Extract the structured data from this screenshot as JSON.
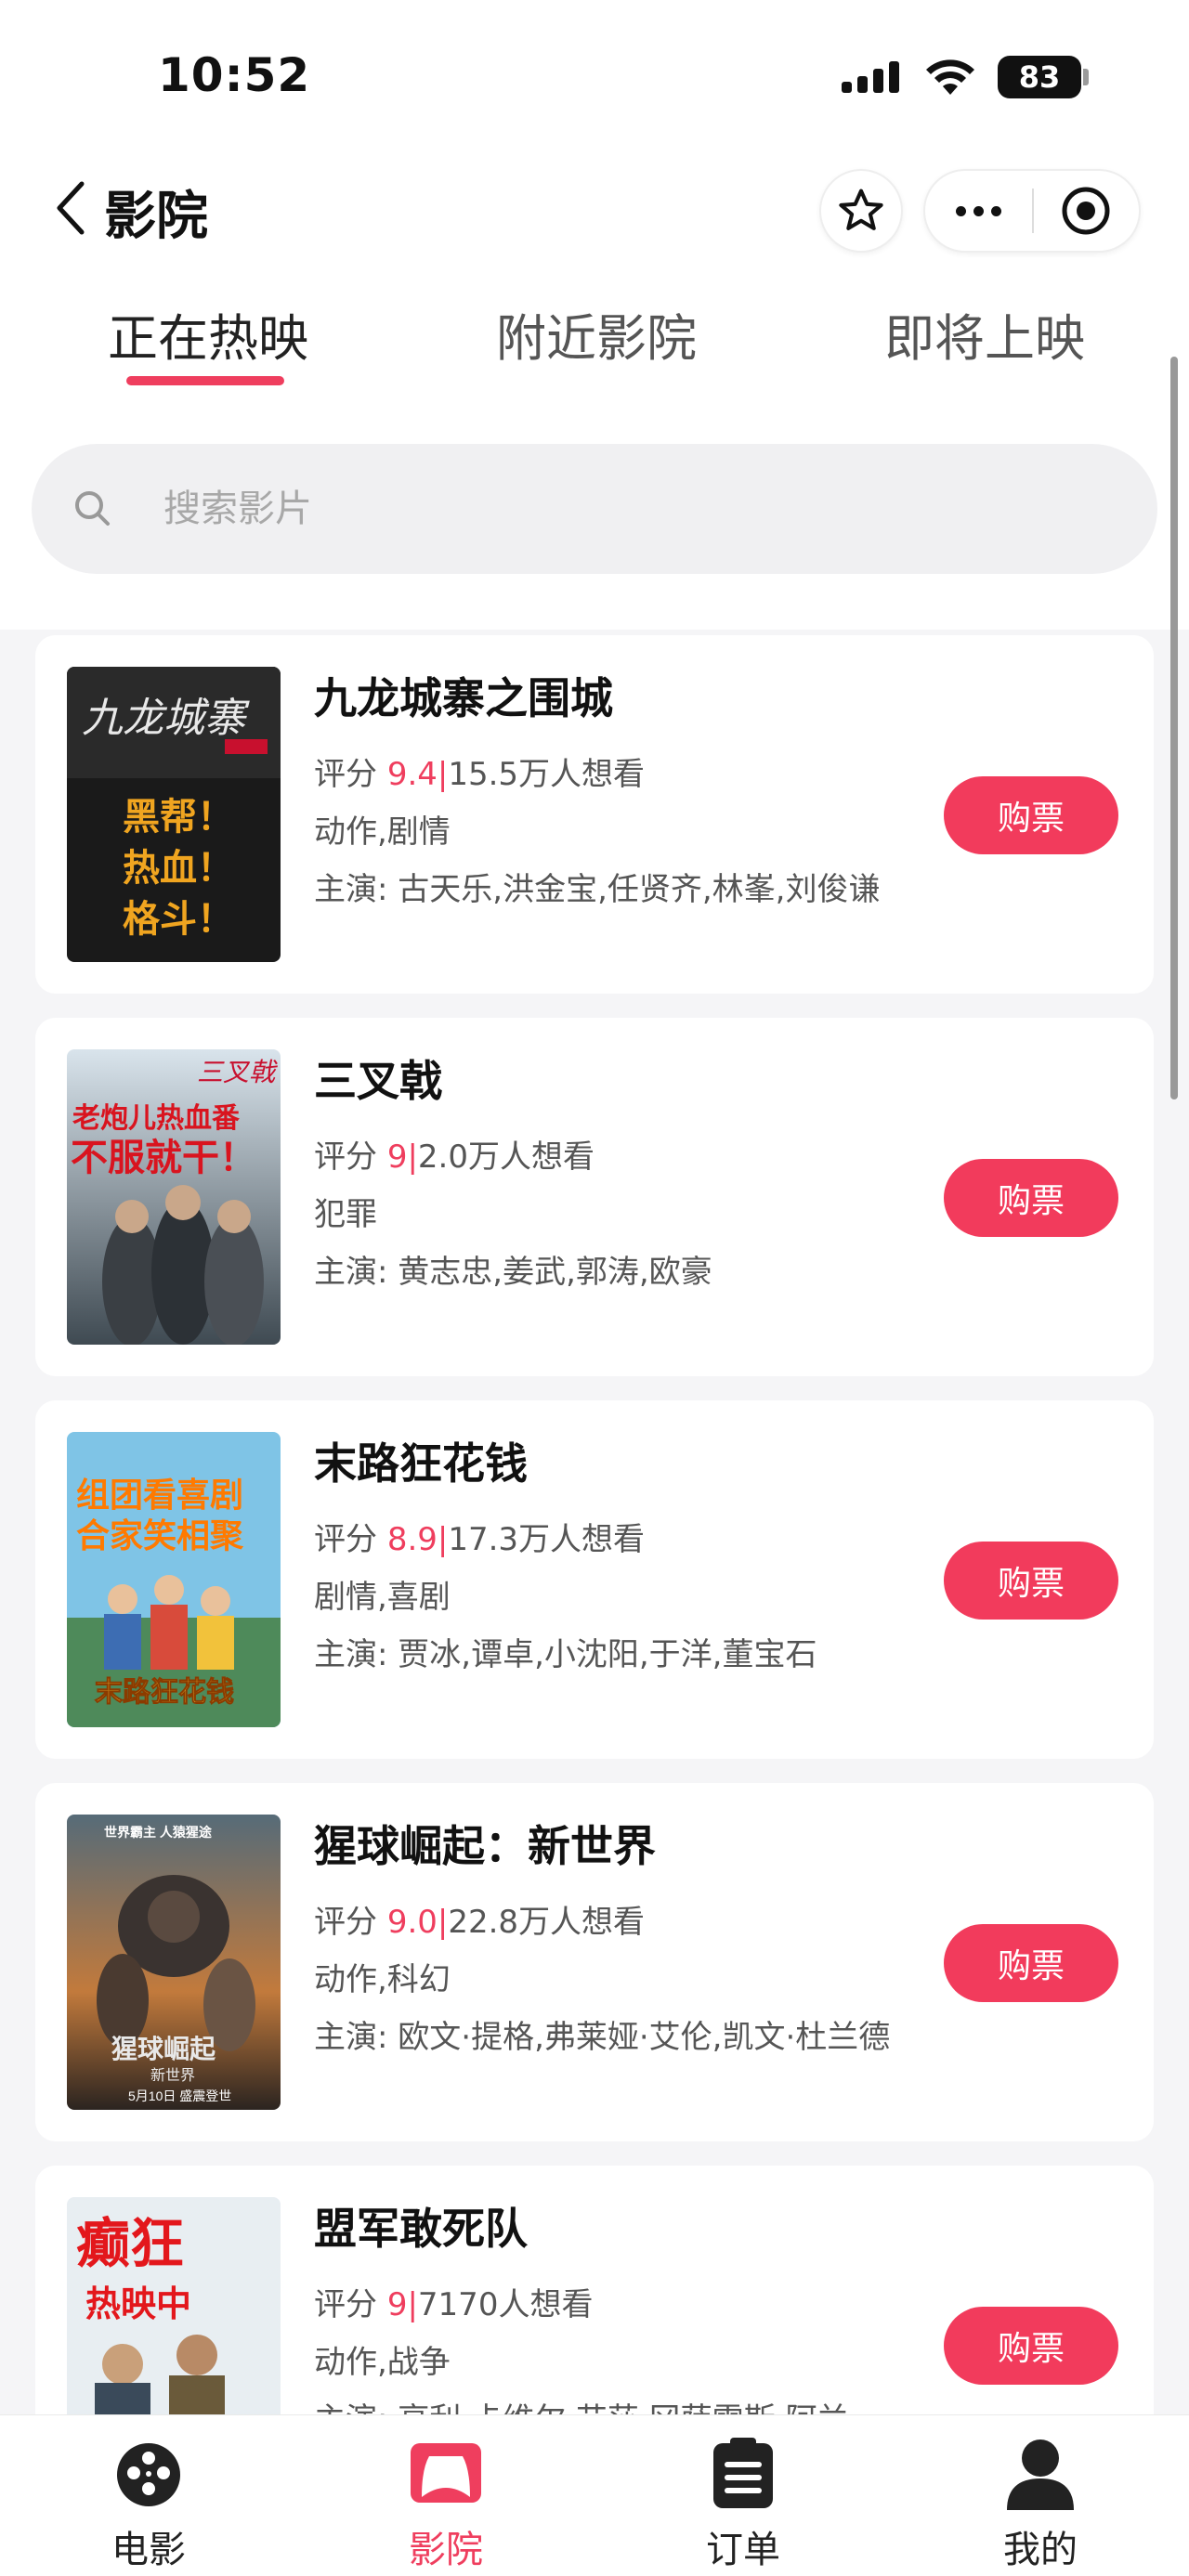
{
  "status_bar": {
    "time": "10:52",
    "battery": "83"
  },
  "nav": {
    "title": "影院"
  },
  "tabs": [
    {
      "label": "正在热映",
      "active": true
    },
    {
      "label": "附近影院",
      "active": false
    },
    {
      "label": "即将上映",
      "active": false
    }
  ],
  "search": {
    "placeholder": "搜索影片"
  },
  "movies": [
    {
      "title": "九龙城寨之围城",
      "rating_label": "评分",
      "score": "9.4",
      "want": "15.5万人想看",
      "genre": "动作,剧情",
      "cast": "主演: 古天乐,洪金宝,任贤齐,林峯,刘俊谦",
      "buy_label": "购票",
      "poster_text": [
        "九龙城寨",
        "黑帮！",
        "热血！",
        "格斗！"
      ]
    },
    {
      "title": "三叉戟",
      "rating_label": "评分",
      "score": "9",
      "want": "2.0万人想看",
      "genre": "犯罪",
      "cast": "主演: 黄志忠,姜武,郭涛,欧豪",
      "buy_label": "购票",
      "poster_text": [
        "三叉戟",
        "老炮儿热血番",
        "不服就干！"
      ]
    },
    {
      "title": "末路狂花钱",
      "rating_label": "评分",
      "score": "8.9",
      "want": "17.3万人想看",
      "genre": "剧情,喜剧",
      "cast": "主演: 贾冰,谭卓,小沈阳,于洋,董宝石",
      "buy_label": "购票",
      "poster_text": [
        "组团看喜剧",
        "合家笑相聚",
        "末路狂花钱"
      ]
    },
    {
      "title": "猩球崛起：新世界",
      "rating_label": "评分",
      "score": "9.0",
      "want": "22.8万人想看",
      "genre": "动作,科幻",
      "cast": "主演: 欧文·提格,弗莱娅·艾伦,凯文·杜兰德",
      "buy_label": "购票",
      "poster_text": [
        "世界霸主 人猿猩途",
        "猩球崛起",
        "新世界",
        "5月10日 盛震登世"
      ]
    },
    {
      "title": "盟军敢死队",
      "rating_label": "评分",
      "score": "9",
      "want": "7170人想看",
      "genre": "动作,战争",
      "cast": "主演: 亨利·卡维尔,艾莎·冈萨雷斯,阿兰",
      "buy_label": "购票",
      "poster_text": [
        "癫狂",
        "热映中"
      ]
    }
  ],
  "tabbar": [
    {
      "label": "电影",
      "icon": "film-reel-icon",
      "active": false
    },
    {
      "label": "影院",
      "icon": "cinema-screen-icon",
      "active": true
    },
    {
      "label": "订单",
      "icon": "clipboard-icon",
      "active": false
    },
    {
      "label": "我的",
      "icon": "person-icon",
      "active": false
    }
  ],
  "colors": {
    "accent": "#ef3e5e",
    "button": "#f23b5c",
    "background": "#f5f5f7"
  }
}
